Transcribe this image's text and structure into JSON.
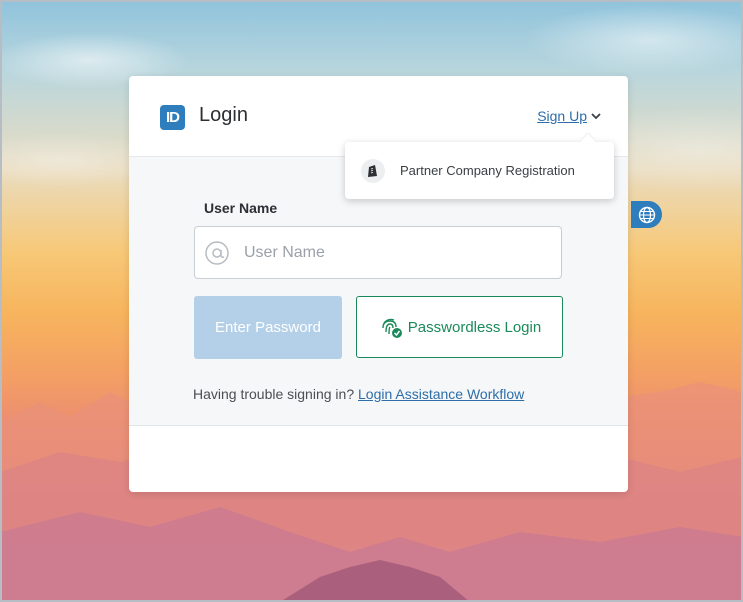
{
  "header": {
    "logo_text": "ID",
    "title": "Login",
    "signup_label": "Sign Up"
  },
  "signup_menu": {
    "items": [
      {
        "label": "Partner Company Registration",
        "icon": "building-icon"
      }
    ]
  },
  "form": {
    "username_label": "User Name",
    "username_placeholder": "User Name",
    "username_value": "",
    "enter_password_label": "Enter Password",
    "passwordless_label": "Passwordless Login"
  },
  "help": {
    "text": "Having trouble signing in?",
    "link_label": "Login Assistance Workflow"
  },
  "colors": {
    "accent": "#2e7dbd",
    "success": "#1b8a5a",
    "link": "#2e6ea8",
    "disabled_button": "#b3d0e8"
  },
  "language_button_icon": "globe-icon"
}
